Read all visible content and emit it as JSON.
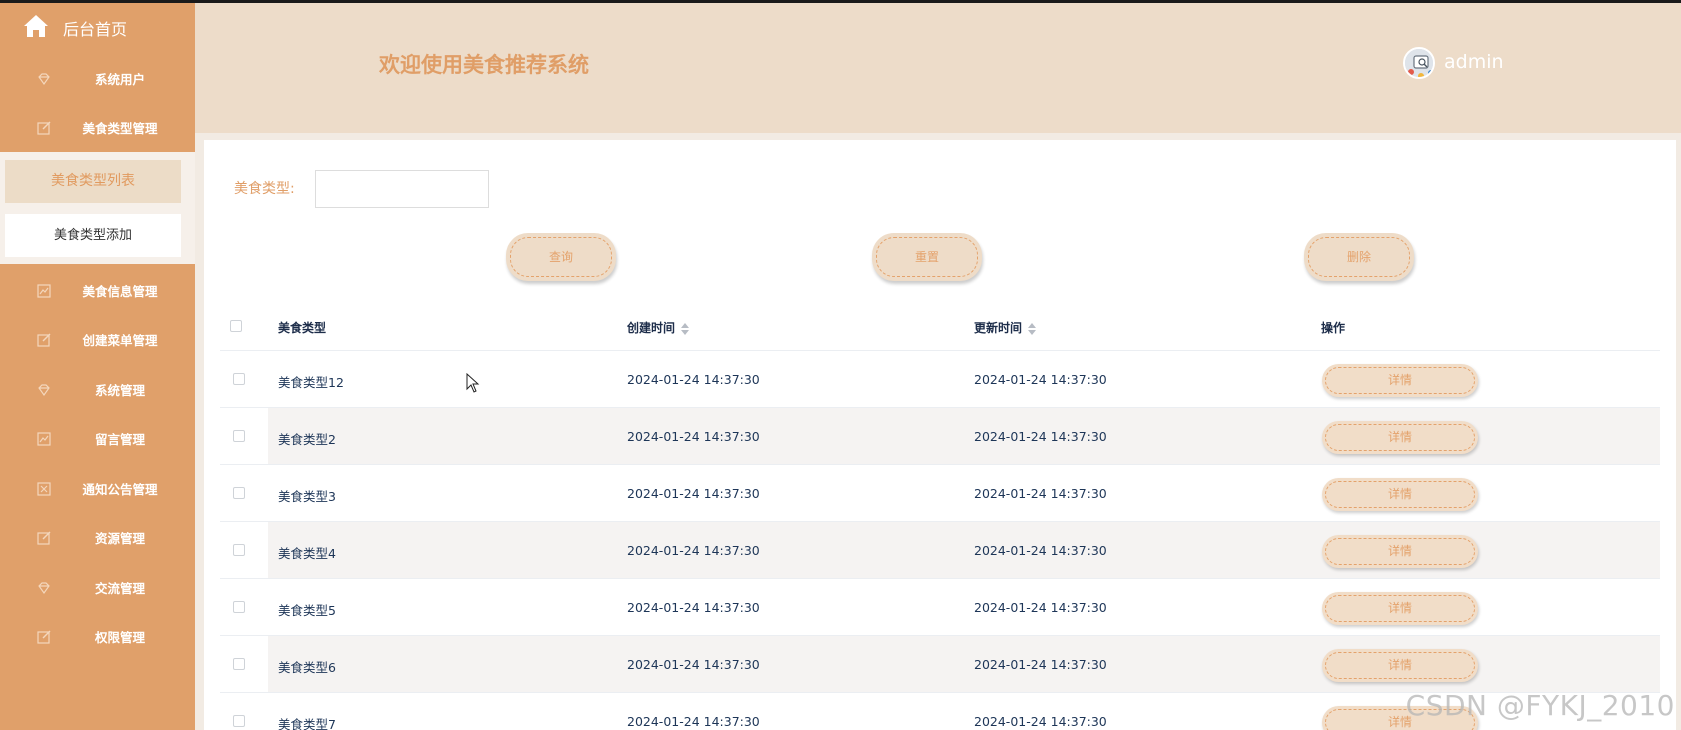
{
  "sidebar": {
    "home_label": "后台首页",
    "items": [
      {
        "label": "系统用户",
        "icon": "gem-icon"
      },
      {
        "label": "美食类型管理",
        "icon": "edit-icon"
      },
      {
        "label": "美食信息管理",
        "icon": "chart-icon"
      },
      {
        "label": "创建菜单管理",
        "icon": "edit-icon"
      },
      {
        "label": "系统管理",
        "icon": "gem-icon"
      },
      {
        "label": "留言管理",
        "icon": "chart-icon"
      },
      {
        "label": "通知公告管理",
        "icon": "close-box-icon"
      },
      {
        "label": "资源管理",
        "icon": "edit-icon"
      },
      {
        "label": "交流管理",
        "icon": "gem-icon"
      },
      {
        "label": "权限管理",
        "icon": "edit-icon"
      }
    ],
    "submenu": {
      "active": "美食类型列表",
      "add": "美食类型添加"
    }
  },
  "header": {
    "title": "欢迎使用美食推荐系统",
    "username": "admin"
  },
  "filter": {
    "label": "美食类型:",
    "value": ""
  },
  "buttons": {
    "search": "查询",
    "reset": "重置",
    "delete": "删除"
  },
  "table": {
    "columns": [
      "美食类型",
      "创建时间",
      "更新时间",
      "操作"
    ],
    "detail_label": "详情",
    "rows": [
      {
        "type": "美食类型12",
        "created": "2024-01-24 14:37:30",
        "updated": "2024-01-24 14:37:30"
      },
      {
        "type": "美食类型2",
        "created": "2024-01-24 14:37:30",
        "updated": "2024-01-24 14:37:30"
      },
      {
        "type": "美食类型3",
        "created": "2024-01-24 14:37:30",
        "updated": "2024-01-24 14:37:30"
      },
      {
        "type": "美食类型4",
        "created": "2024-01-24 14:37:30",
        "updated": "2024-01-24 14:37:30"
      },
      {
        "type": "美食类型5",
        "created": "2024-01-24 14:37:30",
        "updated": "2024-01-24 14:37:30"
      },
      {
        "type": "美食类型6",
        "created": "2024-01-24 14:37:30",
        "updated": "2024-01-24 14:37:30"
      },
      {
        "type": "美食类型7",
        "created": "2024-01-24 14:37:30",
        "updated": "2024-01-24 14:37:30"
      }
    ]
  },
  "watermark": "CSDN @FYKJ_2010",
  "colors": {
    "sidebar": "#e0a06a",
    "header": "#eddcc9",
    "accent": "#e09e67"
  }
}
